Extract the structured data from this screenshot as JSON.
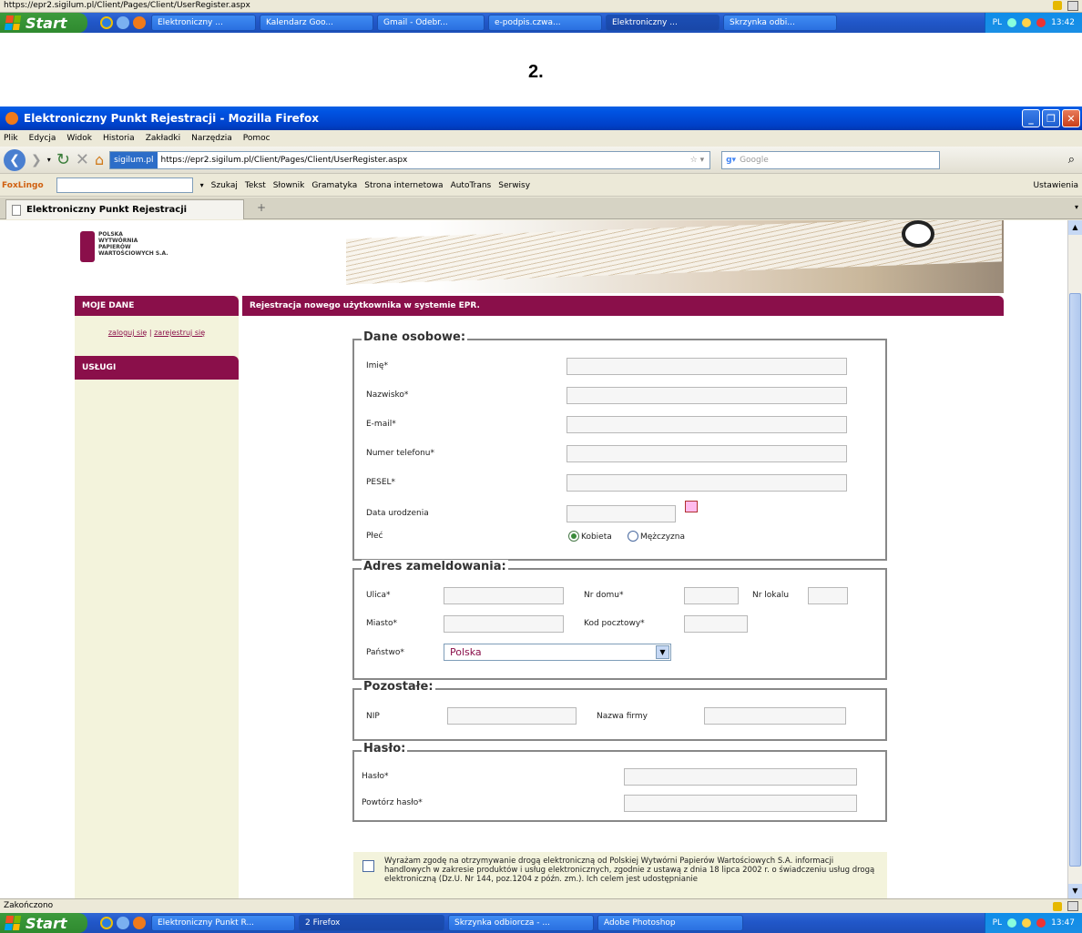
{
  "top_status": {
    "url": "https://epr2.sigilum.pl/Client/Pages/Client/UserRegister.aspx"
  },
  "taskbar_top": {
    "start": "Start",
    "tasks": [
      "Elektroniczny ...",
      "Kalendarz Goo...",
      "Gmail - Odebr...",
      "e-podpis.czwa...",
      "Elektroniczny ...",
      "Skrzynka odbi..."
    ],
    "lang": "PL",
    "time": "13:42"
  },
  "step_label": "2.",
  "window": {
    "title": "Elektroniczny Punkt Rejestracji - Mozilla Firefox"
  },
  "menu": [
    "Plik",
    "Edycja",
    "Widok",
    "Historia",
    "Zakładki",
    "Narzędzia",
    "Pomoc"
  ],
  "nav": {
    "site_badge": "sigilum.pl",
    "url": "https://epr2.sigilum.pl/Client/Pages/Client/UserRegister.aspx",
    "search_placeholder": "Google"
  },
  "foxlingo": {
    "brand": "FoxLingo",
    "items": [
      "Szukaj",
      "Tekst",
      "Słownik",
      "Gramatyka",
      "Strona internetowa",
      "AutoTrans",
      "Serwisy"
    ],
    "settings": "Ustawienia"
  },
  "tab": {
    "label": "Elektroniczny Punkt Rejestracji",
    "new_tab": "+"
  },
  "logo": {
    "lines": [
      "POLSKA",
      "WYTWÓRNIA",
      "PAPIERÓW",
      "WARTOŚCIOWYCH S.A."
    ]
  },
  "sidebar": {
    "moje_dane": "MOJE DANE",
    "zaloguj": "zaloguj się",
    "zarejestruj": "zarejestruj się",
    "sep": "|",
    "uslugi": "USŁUGI"
  },
  "main_header": "Rejestracja nowego użytkownika w systemie EPR.",
  "dane_osobowe": {
    "legend": "Dane osobowe:",
    "imie": "Imię*",
    "nazwisko": "Nazwisko*",
    "email": "E-mail*",
    "telefon": "Numer telefonu*",
    "pesel": "PESEL*",
    "data_urodzenia": "Data urodzenia",
    "plec": "Płeć",
    "kobieta": "Kobieta",
    "mezczyzna": "Mężczyzna"
  },
  "adres": {
    "legend": "Adres zameldowania:",
    "ulica": "Ulica*",
    "nr_domu": "Nr domu*",
    "nr_lokalu": "Nr lokalu",
    "miasto": "Miasto*",
    "kod": "Kod pocztowy*",
    "panstwo": "Państwo*",
    "panstwo_value": "Polska"
  },
  "pozostale": {
    "legend": "Pozostałe:",
    "nip": "NIP",
    "nazwa_firmy": "Nazwa firmy"
  },
  "haslo": {
    "legend": "Hasło:",
    "haslo": "Hasło*",
    "powtorz": "Powtórz hasło*"
  },
  "consent": {
    "text": "Wyrażam zgodę na otrzymywanie drogą elektroniczną od Polskiej Wytwórni Papierów Wartościowych S.A. informacji handlowych w zakresie produktów i usług elektronicznych, zgodnie z ustawą z dnia 18 lipca 2002 r. o świadczeniu usług drogą elektroniczną (Dz.U. Nr 144, poz.1204 z późn. zm.). Ich celem jest udostępnianie"
  },
  "statusbar": {
    "text": "Zakończono"
  },
  "taskbar_bottom": {
    "start": "Start",
    "tasks": [
      "Elektroniczny Punkt R...",
      "2 Firefox",
      "Skrzynka odbiorcza - ...",
      "Adobe Photoshop"
    ],
    "lang": "PL",
    "time": "13:47"
  },
  "colors": {
    "accent": "#8a0f4a",
    "sidebar_bg": "#f3f3dc",
    "xp_blue": "#0054e3"
  }
}
